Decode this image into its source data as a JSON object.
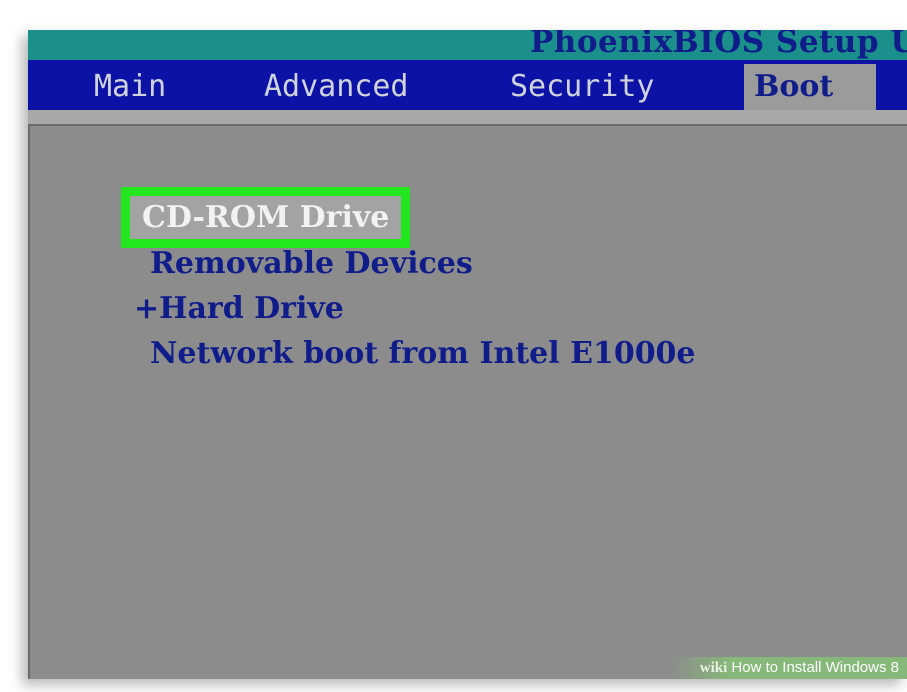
{
  "title_bar": {
    "title": "PhoenixBIOS Setup Ut"
  },
  "menu": {
    "tabs": [
      {
        "label": "Main"
      },
      {
        "label": "Advanced"
      },
      {
        "label": "Security"
      },
      {
        "label": "Boot"
      }
    ],
    "active_tab": "Boot"
  },
  "boot_order": {
    "items": [
      {
        "label": "CD-ROM Drive",
        "selected": true
      },
      {
        "label": "Removable Devices"
      },
      {
        "label": "+Hard Drive"
      },
      {
        "label": "Network boot from Intel E1000e"
      }
    ]
  },
  "watermark": {
    "logo": "wiki",
    "text": "How to Install Windows 8"
  },
  "colors": {
    "title_bar": "#1a8f8b",
    "menu_bar": "#0c12a6",
    "panel": "#8c8c8c",
    "item_text": "#0f1c8a",
    "highlight_outline": "#22e61e"
  }
}
